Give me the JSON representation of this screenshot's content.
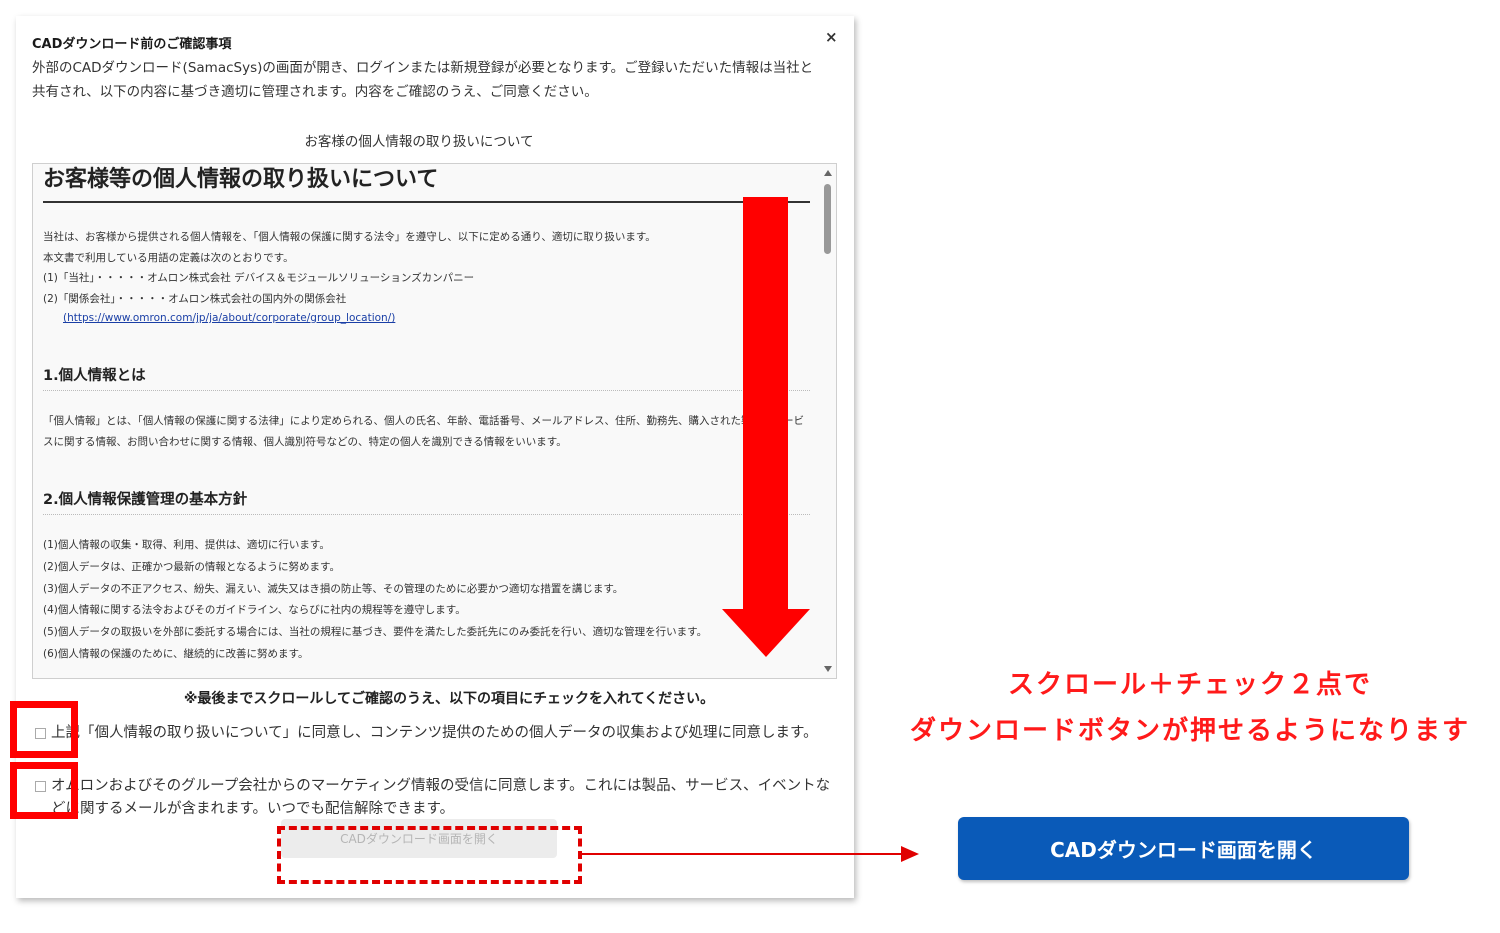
{
  "modal": {
    "title": "CADダウンロード前のご確認事項",
    "description": "外部のCADダウンロード(SamacSys)の画面が開き、ログインまたは新規登録が必要となります。ご登録いただいた情報は当社と共有され、以下の内容に基づき適切に管理されます。内容をご確認のうえ、ご同意ください。",
    "close_label": "×",
    "policy_heading": "お客様の個人情報の取り扱いについて"
  },
  "document": {
    "title": "お客様等の個人情報の取り扱いについて",
    "intro_lines": [
      "当社は、お客様から提供される個人情報を、「個人情報の保護に関する法令」を遵守し、以下に定める通り、適切に取り扱います。",
      "本文書で利用している用語の定義は次のとおりです。",
      "(1)「当社」・・・・・オムロン株式会社 デバイス＆モジュールソリューションズカンパニー",
      "(2)「関係会社」・・・・・オムロン株式会社の国内外の関係会社"
    ],
    "link": "(https://www.omron.com/jp/ja/about/corporate/group_location/)",
    "section1_title": "1.個人情報とは",
    "section1_text": "「個人情報」とは、「個人情報の保護に関する法律」により定められる、個人の氏名、年齢、電話番号、メールアドレス、住所、勤務先、購入された製品やサービスに関する情報、お問い合わせに関する情報、個人識別符号などの、特定の個人を識別できる情報をいいます。",
    "section2_title": "2.個人情報保護管理の基本方針",
    "section2_items": [
      "(1)個人情報の収集・取得、利用、提供は、適切に行います。",
      "(2)個人データは、正確かつ最新の情報となるように努めます。",
      "(3)個人データの不正アクセス、紛失、漏えい、滅失又はき損の防止等、その管理のために必要かつ適切な措置を講じます。",
      "(4)個人情報に関する法令およびそのガイドライン、ならびに社内の規程等を遵守します。",
      "(5)個人データの取扱いを外部に委託する場合には、当社の規程に基づき、要件を満たした委託先にのみ委託を行い、適切な管理を行います。",
      "(6)個人情報の保護のために、継続的に改善に努めます。"
    ]
  },
  "instruction": "※最後までスクロールしてご確認のうえ、以下の項目にチェックを入れてください。",
  "consents": [
    {
      "text": "上記「個人情報の取り扱いについて」に同意し、コンテンツ提供のための個人データの収集および処理に同意します。",
      "checked": false
    },
    {
      "text": "オムロンおよびそのグループ会社からのマーケティング情報の受信に同意します。これには製品、サービス、イベントなどに関するメールが含まれます。いつでも配信解除できます。",
      "checked": false
    }
  ],
  "buttons": {
    "cad_disabled": "CADダウンロード画面を開く",
    "cad_enabled": "CADダウンロード画面を開く"
  },
  "annotation": {
    "line1": "スクロール＋チェック２点で",
    "line2": "ダウンロードボタンが押せるようになります",
    "color": "#ff1a1a"
  },
  "colors": {
    "accent_red": "#ff0000",
    "button_blue": "#0a5ab8"
  }
}
